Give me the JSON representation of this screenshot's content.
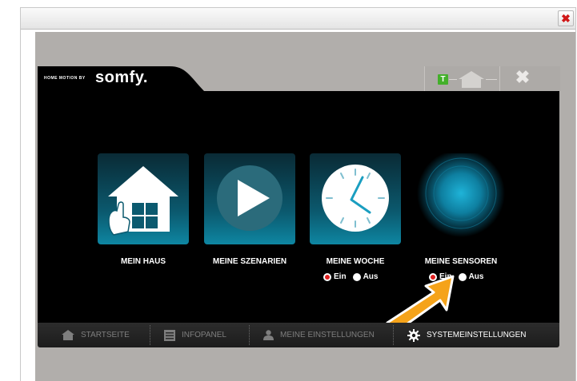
{
  "window": {
    "close_symbol": "✖"
  },
  "header": {
    "tagline": "HOME MOTION BY",
    "brand": "somfy.",
    "icons": {
      "tahoma": "T",
      "house": "house-icon",
      "close": "✖"
    }
  },
  "tiles": [
    {
      "label": "MEIN HAUS",
      "icon": "house-hand-icon"
    },
    {
      "label": "MEINE SZENARIEN",
      "icon": "play-icon"
    },
    {
      "label": "MEINE WOCHE",
      "icon": "clock-icon",
      "radio": {
        "on_label": "Ein",
        "off_label": "Aus",
        "selected": "Ein"
      }
    },
    {
      "label": "MEINE SENSOREN",
      "icon": "sensor-glow-icon",
      "radio": {
        "on_label": "Ein",
        "off_label": "Aus",
        "selected": "Ein"
      }
    }
  ],
  "nav": [
    {
      "label": "STARTSEITE",
      "icon": "home-icon",
      "active": false
    },
    {
      "label": "INFOPANEL",
      "icon": "list-icon",
      "active": false
    },
    {
      "label": "MEINE EINSTELLUNGEN",
      "icon": "person-icon",
      "active": false
    },
    {
      "label": "SYSTEMEINSTELLUNGEN",
      "icon": "gear-icon",
      "active": true
    }
  ],
  "colors": {
    "accent_blue": "#0e86a2",
    "selected_radio": "#e02020",
    "tahoma_green": "#43b02a",
    "stage_gray": "#b1aeab",
    "pointer_orange": "#f5a31a"
  }
}
